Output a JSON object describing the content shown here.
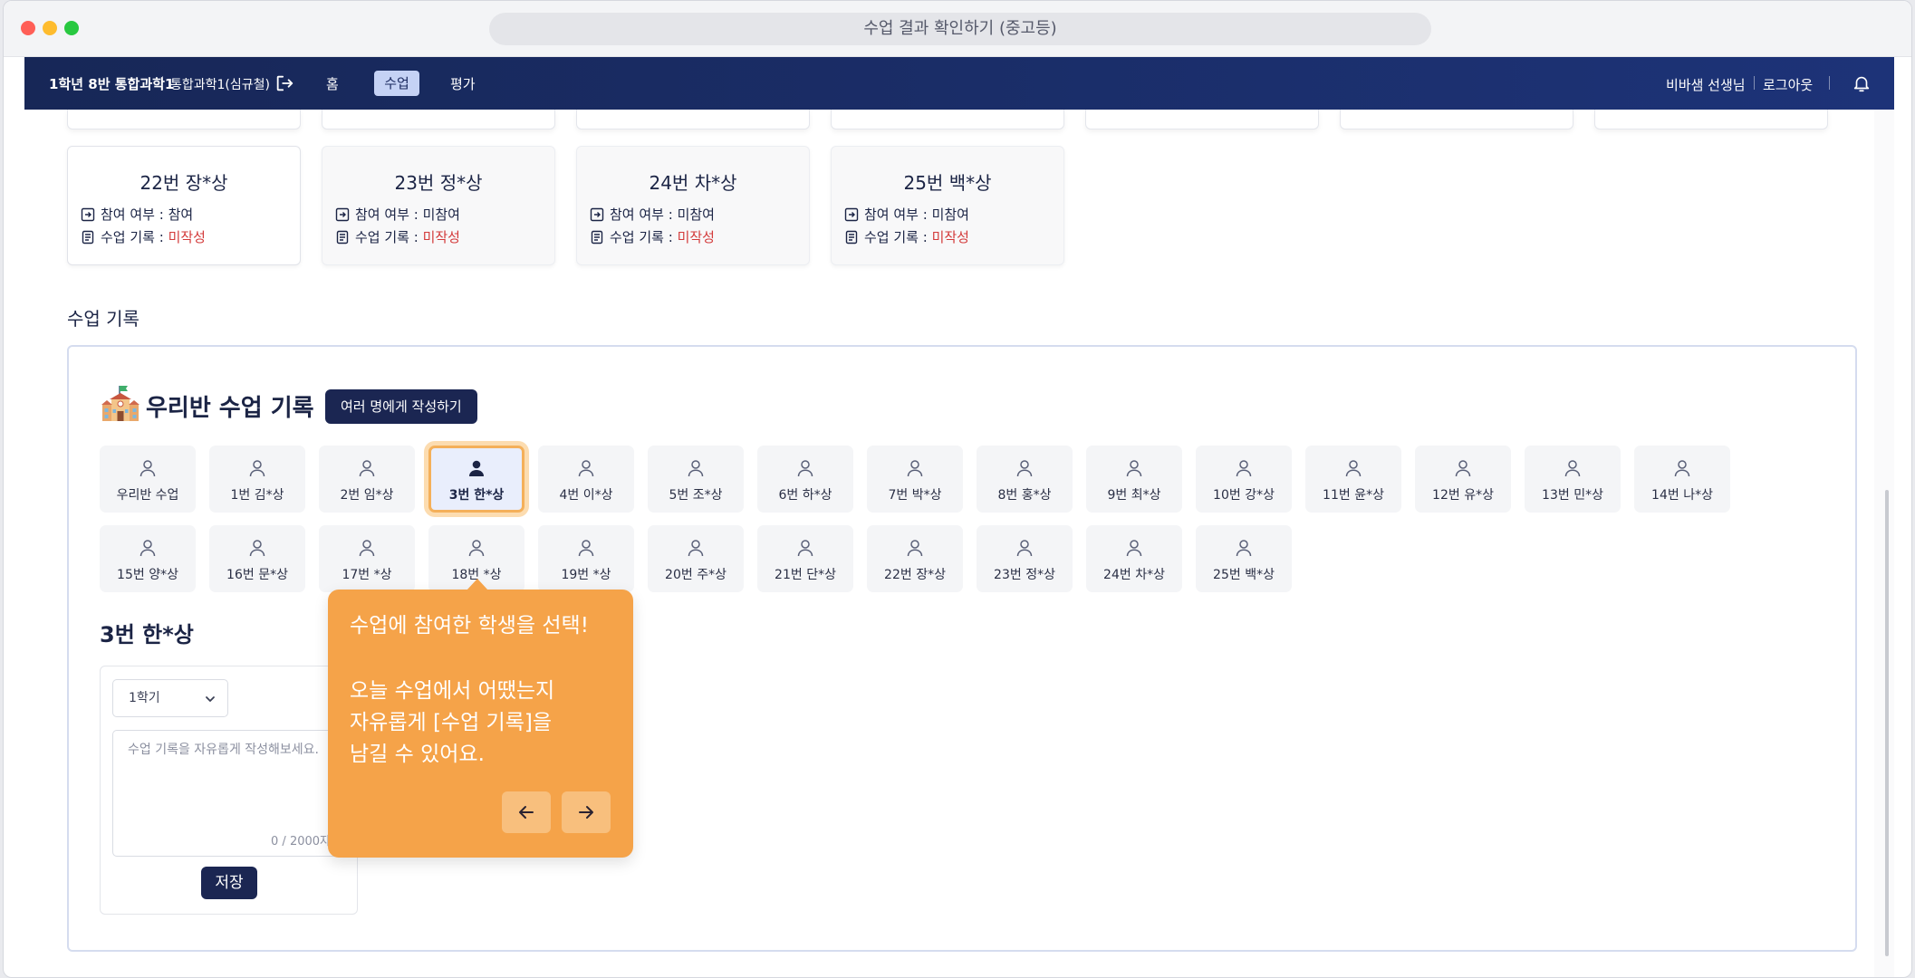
{
  "window": {
    "title": "수업 결과 확인하기 (중고등)"
  },
  "nav": {
    "class_name": "1학년 8반 통합과학1",
    "subject": "통합과학1(심규철)",
    "home": "홈",
    "lesson": "수업",
    "evaluation": "평가",
    "user": "비바샘 선생님",
    "logout": "로그아웃"
  },
  "cards": [
    {
      "name": "22번 장*상",
      "participation_label": "참여 여부 : ",
      "participation": "참여",
      "record_label": "수업 기록 : ",
      "record": "미작성"
    },
    {
      "name": "23번 정*상",
      "participation_label": "참여 여부 : ",
      "participation": "미참여",
      "record_label": "수업 기록 : ",
      "record": "미작성"
    },
    {
      "name": "24번 차*상",
      "participation_label": "참여 여부 : ",
      "participation": "미참여",
      "record_label": "수업 기록 : ",
      "record": "미작성"
    },
    {
      "name": "25번 백*상",
      "participation_label": "참여 여부 : ",
      "participation": "미참여",
      "record_label": "수업 기록 : ",
      "record": "미작성"
    }
  ],
  "section_title": "수업 기록",
  "panel": {
    "title": "우리반 수업 기록",
    "multi_button": "여러 명에게 작성하기",
    "students_row1": [
      "우리반 수업",
      "1번 김*상",
      "2번 임*상",
      "3번 한*상",
      "4번 이*상",
      "5번 조*상",
      "6번 하*상",
      "7번 박*상",
      "8번 홍*상",
      "9번 최*상",
      "10번 강*상",
      "11번 윤*상",
      "12번 유*상",
      "13번 민*상",
      "14번 나*상"
    ],
    "students_row2": [
      "15번 양*상",
      "16번 문*상",
      "17번 *상",
      "18번 *상",
      "19번 *상",
      "20번 주*상",
      "21번 단*상",
      "22번 장*상",
      "23번 정*상",
      "24번 차*상",
      "25번 백*상"
    ],
    "selected_student": "3번 한*상"
  },
  "editor": {
    "semester": "1학기",
    "placeholder": "수업 기록을 자유롭게 작성해보세요.",
    "counter": "0 / 2000자",
    "save": "저장"
  },
  "tooltip": {
    "line1": "수업에 참여한 학생을 선택!",
    "line2": "오늘 수업에서 어땠는지",
    "line3": "자유롭게 [수업 기록]을",
    "line4": "남길 수 있어요."
  },
  "colors": {
    "navbar": "#172757",
    "accent": "#f5a349",
    "warning": "#d33a3a",
    "button": "#1b2652"
  }
}
